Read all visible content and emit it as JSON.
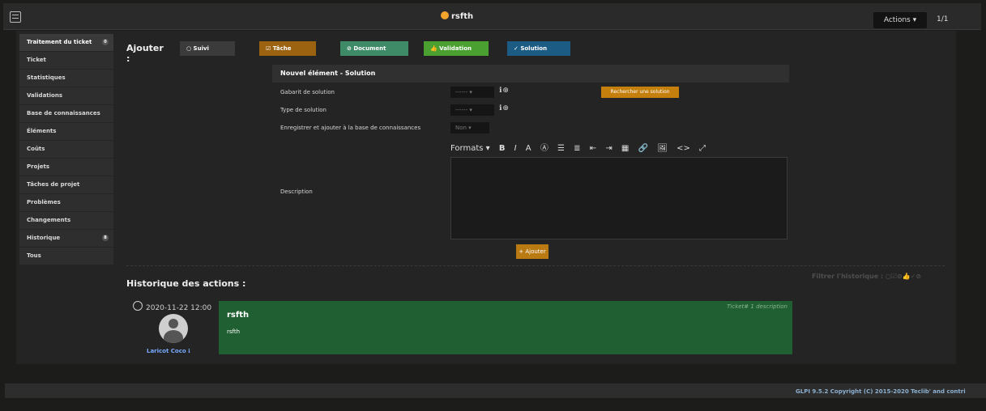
{
  "topbar": {
    "title": "rsfth",
    "actions_label": "Actions ▾",
    "pager": "1/1"
  },
  "sidebar": {
    "items": [
      {
        "label": "Traitement du ticket",
        "badge": "0"
      },
      {
        "label": "Ticket"
      },
      {
        "label": "Statistiques"
      },
      {
        "label": "Validations"
      },
      {
        "label": "Base de connaissances"
      },
      {
        "label": "Éléments"
      },
      {
        "label": "Coûts"
      },
      {
        "label": "Projets"
      },
      {
        "label": "Tâches de projet"
      },
      {
        "label": "Problèmes"
      },
      {
        "label": "Changements"
      },
      {
        "label": "Historique",
        "badge": "8"
      },
      {
        "label": "Tous"
      }
    ]
  },
  "add_row": {
    "label": "Ajouter :",
    "buttons": {
      "suivi": "Suivi",
      "tache": "Tâche",
      "document": "Document",
      "validation": "Validation",
      "solution": "Solution"
    }
  },
  "form": {
    "header": "Nouvel élément - Solution",
    "template_label": "Gabarit de solution",
    "template_value": "------ ▾",
    "type_label": "Type de solution",
    "type_value": "------ ▾",
    "save_kb_label": "Enregistrer et ajouter à la base de connaissances",
    "save_kb_value": "Non ▾",
    "search_button": "Rechercher une solution",
    "description_label": "Description",
    "toolbar_formats": "Formats ▾",
    "submit_label": "+ Ajouter"
  },
  "history": {
    "title": "Historique des actions :",
    "filter_label": "Filtrer l'historique :",
    "entry": {
      "timestamp": "2020-11-22 12:00",
      "author": "Laricot Coco",
      "meta": "Ticket# 1 description",
      "heading": "rsfth",
      "text": "rsfth"
    }
  },
  "footer": {
    "copyright": "GLPI 9.5.2 Copyright (C) 2015-2020 Teclib' and contri"
  }
}
